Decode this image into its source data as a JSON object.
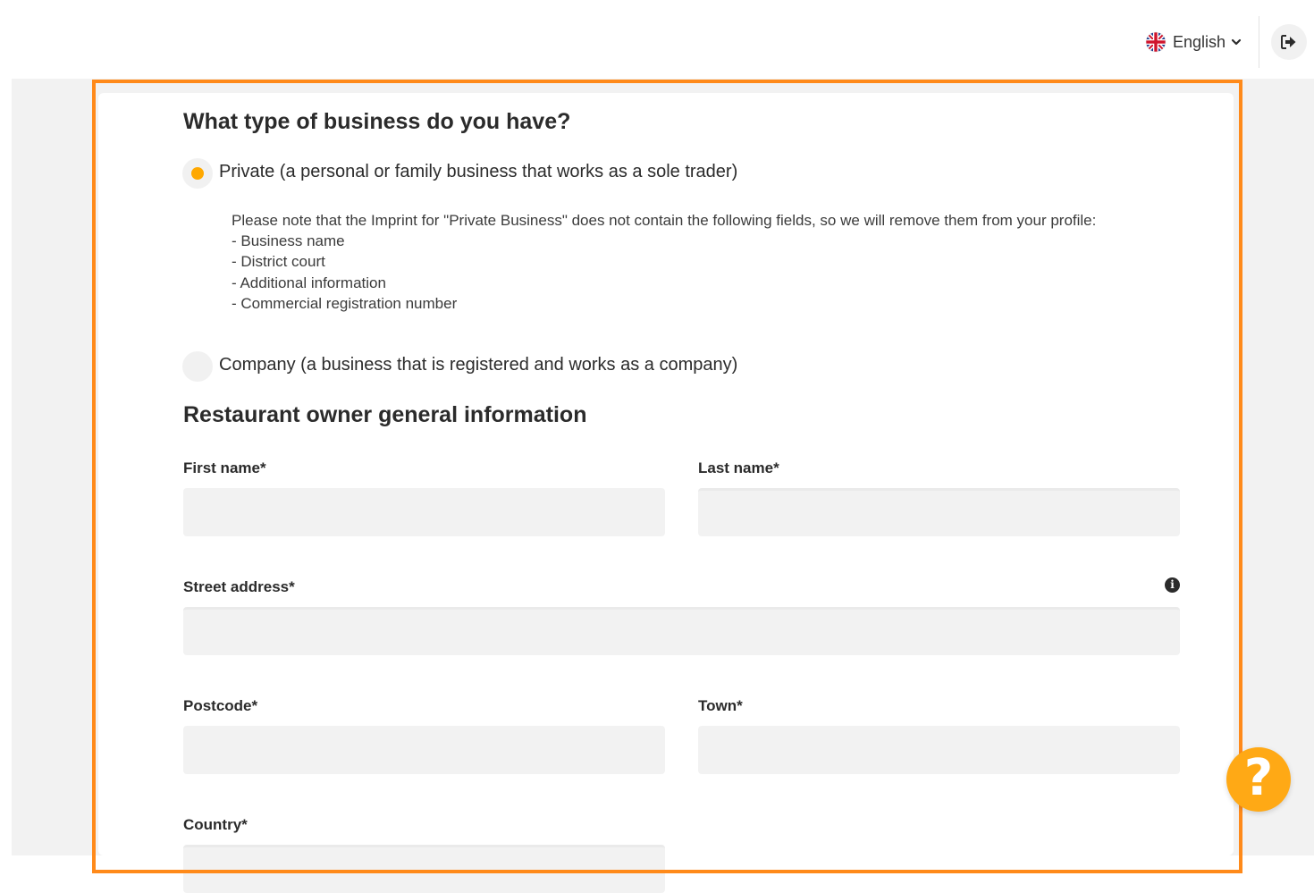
{
  "header": {
    "language": "English",
    "flag_icon": "uk-flag-icon",
    "dropdown_icon": "chevron-down-icon",
    "logout_icon": "sign-out-icon"
  },
  "business_type": {
    "heading": "What type of business do you have?",
    "options": [
      {
        "label": "Private (a personal or family business that works as a sole trader)",
        "selected": true
      },
      {
        "label": "Company (a business that is registered and works as a company)",
        "selected": false
      }
    ],
    "note": {
      "text": "Please note that the Imprint for \"Private Business\" does not contain the following fields, so we will remove them from your profile:",
      "items": [
        "- Business name",
        "- District court",
        "- Additional information",
        "- Commercial registration number"
      ]
    }
  },
  "owner_info": {
    "heading": "Restaurant owner general information",
    "first_name": {
      "label": "First name*",
      "value": ""
    },
    "last_name": {
      "label": "Last name*",
      "value": ""
    },
    "street_address": {
      "label": "Street address*",
      "value": "",
      "info_icon": "info-circle-icon"
    },
    "postcode": {
      "label": "Postcode*",
      "value": ""
    },
    "town": {
      "label": "Town*",
      "value": ""
    },
    "country": {
      "label": "Country*",
      "value": ""
    }
  },
  "help_button": {
    "icon": "question-mark-icon",
    "glyph": "?"
  },
  "colors": {
    "accent": "#ffa800",
    "highlight_border": "#ff8a1a",
    "field_bg": "#f2f2f2",
    "page_bg": "#f2f2f2"
  }
}
